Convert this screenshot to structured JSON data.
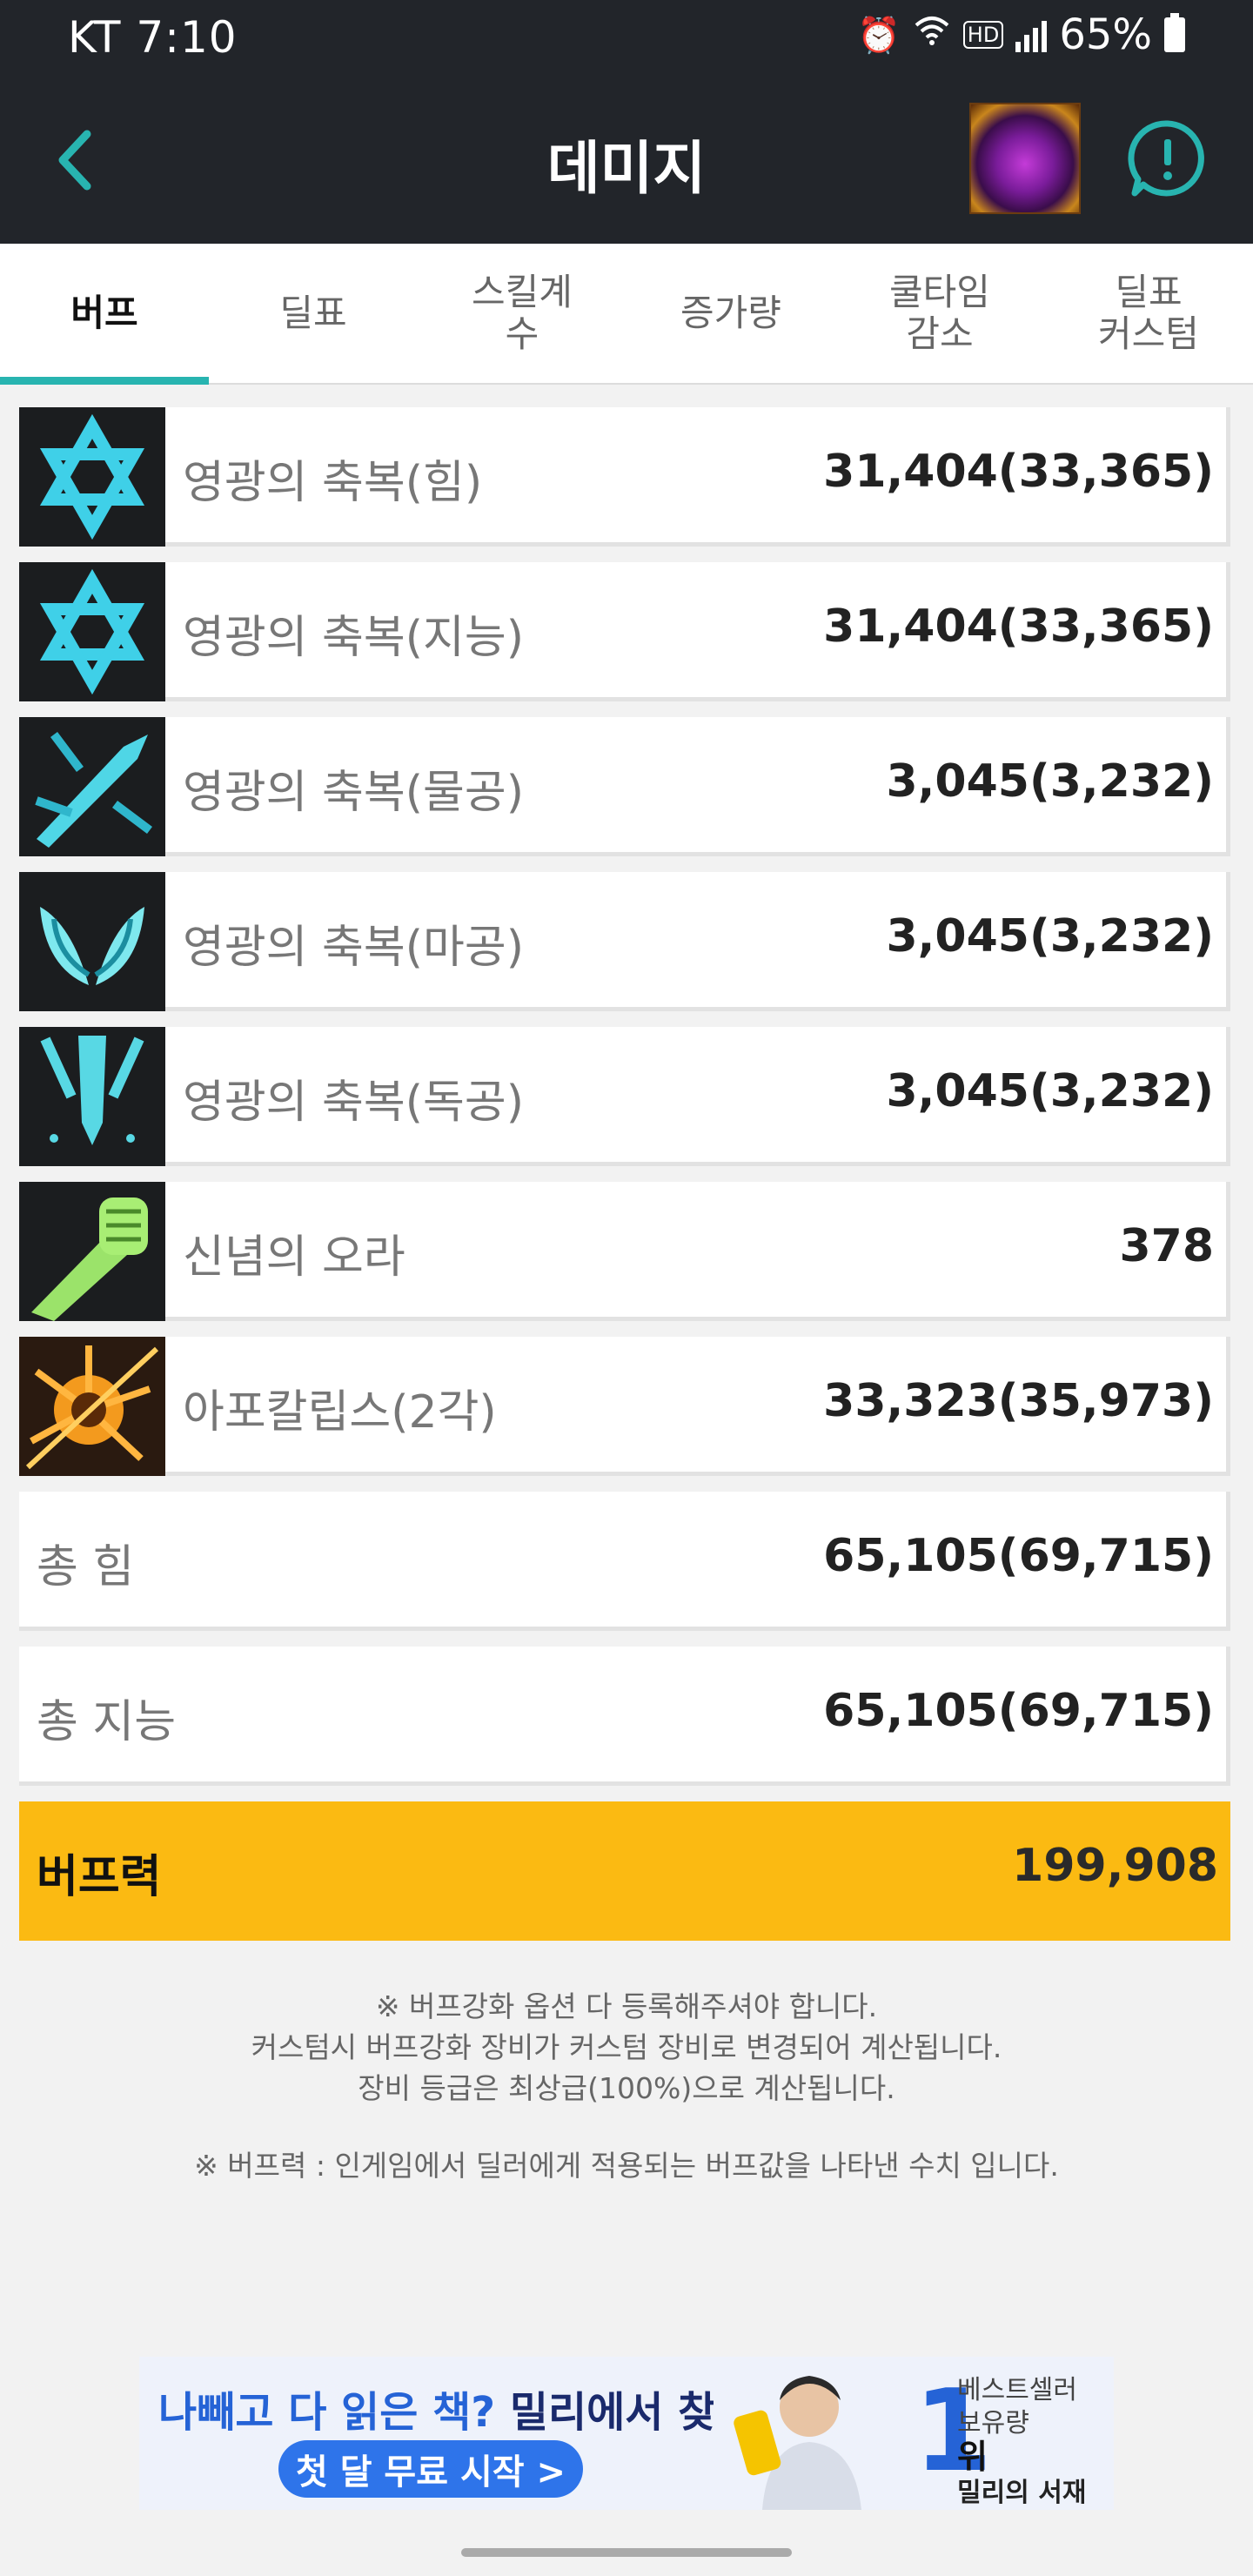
{
  "status_bar": {
    "carrier_time": "KT 7:10",
    "battery": "65%",
    "hd": "HD"
  },
  "app_bar": {
    "title": "데미지"
  },
  "tabs": [
    {
      "label": "버프",
      "active": true
    },
    {
      "label": "딜표",
      "active": false
    },
    {
      "label": "스킬계\n수",
      "active": false
    },
    {
      "label": "증가량",
      "active": false
    },
    {
      "label": "쿨타임\n감소",
      "active": false
    },
    {
      "label": "딜표\n커스텀",
      "active": false
    }
  ],
  "buffs": [
    {
      "name": "영광의 축복(힘)",
      "value": "31,404(33,365)",
      "icon": "hexagram-icon"
    },
    {
      "name": "영광의 축복(지능)",
      "value": "31,404(33,365)",
      "icon": "hexagram-icon"
    },
    {
      "name": "영광의 축복(물공)",
      "value": "3,045(3,232)",
      "icon": "sword-icon"
    },
    {
      "name": "영광의 축복(마공)",
      "value": "3,045(3,232)",
      "icon": "wings-icon"
    },
    {
      "name": "영광의 축복(독공)",
      "value": "3,045(3,232)",
      "icon": "dagger-icon"
    },
    {
      "name": "신념의 오라",
      "value": "378",
      "icon": "fist-icon"
    },
    {
      "name": "아포칼립스(2각)",
      "value": "33,323(35,973)",
      "icon": "explosion-icon"
    }
  ],
  "totals": [
    {
      "name": "총 힘",
      "value": "65,105(69,715)"
    },
    {
      "name": "총 지능",
      "value": "65,105(69,715)"
    }
  ],
  "buff_power": {
    "name": "버프력",
    "value": "199,908"
  },
  "notes": {
    "line1": "※ 버프강화 옵션 다 등록해주셔야 합니다.",
    "line2": "커스텀시 버프강화 장비가 커스텀 장비로 변경되어 계산됩니다.",
    "line3": "장비 등급은 최상급(100%)으로 계산됩니다.",
    "line4": "※ 버프력 : 인게임에서 딜러에게 적용되는 버프값을 나타낸 수치 입니다."
  },
  "ad": {
    "headline_a": "나빼고 다 읽은 책?",
    "headline_b": " 밀리에서 찾아봐!",
    "cta": "첫 달 무료 시작 >",
    "rank": "1",
    "side_a": "베스트셀러",
    "side_b": "보유량",
    "side_c": "위",
    "brand": "밀리의 서재"
  },
  "colors": {
    "accent": "#28b4b0",
    "header_bg": "#22252a",
    "buff_power_bg": "#fbba12"
  }
}
